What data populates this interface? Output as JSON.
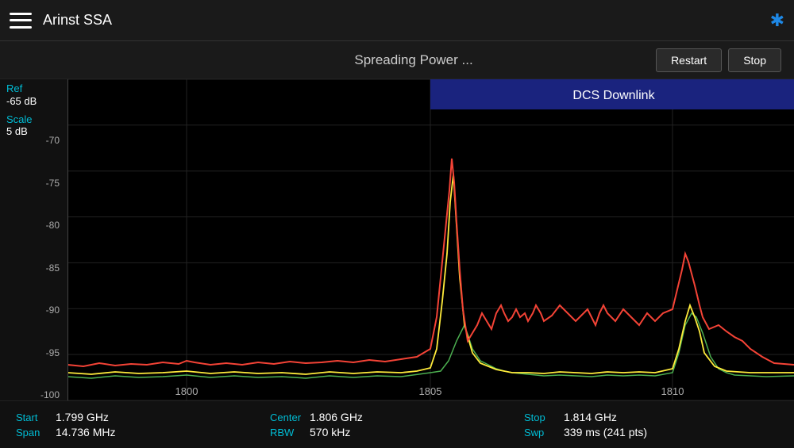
{
  "header": {
    "menu_label": "menu",
    "title": "Arinst SSA",
    "bluetooth_icon": "bluetooth"
  },
  "toolbar": {
    "title": "Spreading Power ...",
    "restart_label": "Restart",
    "stop_label": "Stop"
  },
  "chart": {
    "band_label": "DCS Downlink",
    "db_ticks": [
      "-70",
      "-75",
      "-80",
      "-85",
      "-90",
      "-95",
      "-100"
    ],
    "x_labels": [
      "1800",
      "1805",
      "1810"
    ],
    "colors": {
      "red": "#f44336",
      "yellow": "#ffeb3b",
      "green": "#4caf50",
      "cyan": "#00bcd4"
    }
  },
  "ref": {
    "label": "Ref",
    "value": "-65 dB"
  },
  "scale": {
    "label": "Scale",
    "value": "5  dB"
  },
  "info_bar": {
    "start_key": "Start",
    "start_val": "1.799 GHz",
    "span_key": "Span",
    "span_val": "14.736 MHz",
    "center_key": "Center",
    "center_val": "1.806 GHz",
    "rbw_key": "RBW",
    "rbw_val": "570 kHz",
    "stop_key": "Stop",
    "stop_val": "1.814 GHz",
    "swp_key": "Swp",
    "swp_val": "339 ms (241 pts)"
  }
}
